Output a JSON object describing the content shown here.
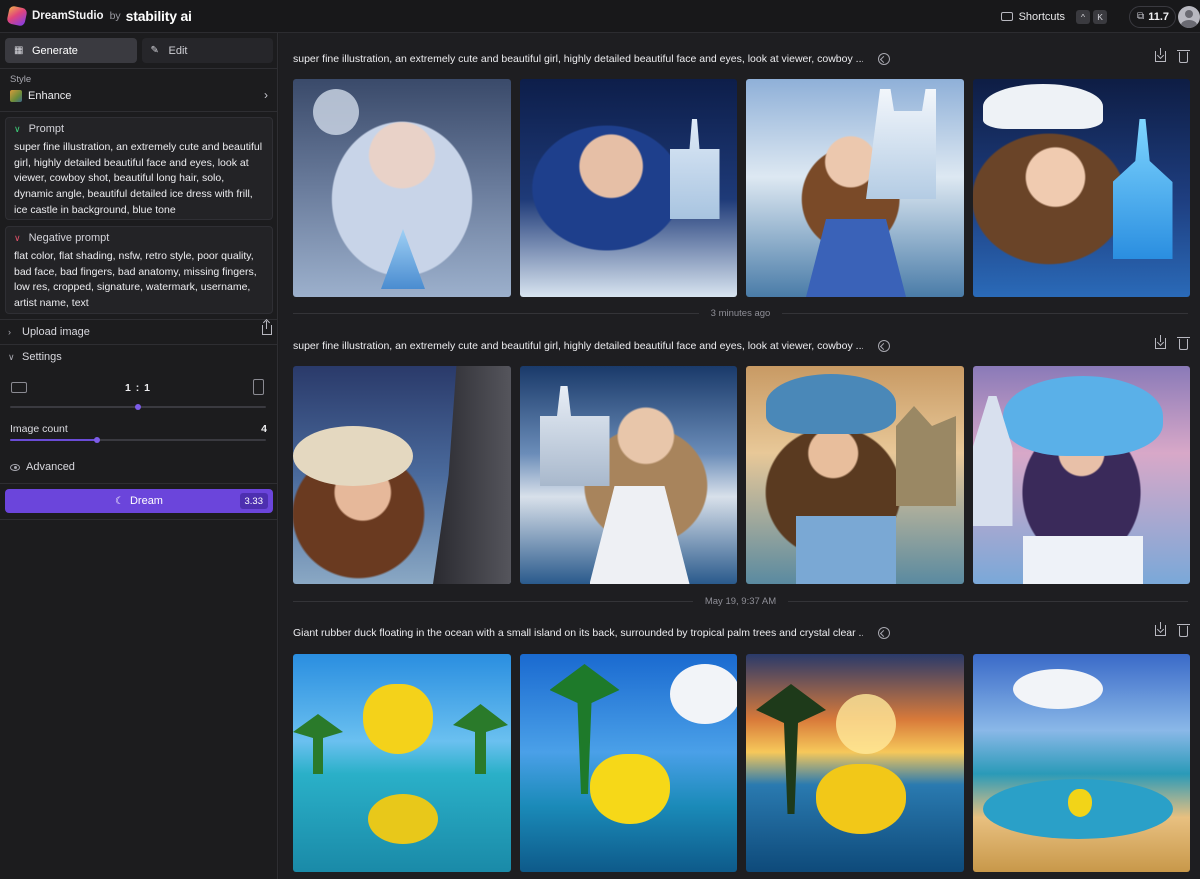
{
  "topbar": {
    "app_name": "DreamStudio",
    "by": "by",
    "company": "stability ai",
    "shortcuts_label": "Shortcuts",
    "keys": [
      "^",
      "K"
    ],
    "credits": "11.7"
  },
  "sidebar": {
    "tabs": [
      {
        "label": "Generate",
        "active": true
      },
      {
        "label": "Edit",
        "active": false
      }
    ],
    "style_label": "Style",
    "style_value": "Enhance",
    "prompt_title": "Prompt",
    "prompt_text": "super fine illustration, an extremely cute and beautiful girl, highly detailed beautiful face and eyes, look at viewer, cowboy shot, beautiful long hair, solo, dynamic angle, beautiful detailed ice dress with frill, ice castle in background, blue tone",
    "negative_title": "Negative prompt",
    "negative_text": "flat color, flat shading, nsfw, retro style, poor quality, bad face, bad fingers, bad anatomy, missing fingers, low res, cropped, signature, watermark, username, artist name, text",
    "upload_label": "Upload image",
    "settings_label": "Settings",
    "aspect_ratio": "1 : 1",
    "aspect_slider_fraction": 0.5,
    "image_count_label": "Image count",
    "image_count": "4",
    "image_count_fraction": 0.34,
    "advanced_label": "Advanced",
    "dream_label": "Dream",
    "dream_cost": "3.33"
  },
  "feed": {
    "groups": [
      {
        "prompt": "super fine illustration, an extremely cute and beautiful girl, highly detailed beautiful face and eyes, look at viewer, cowboy ...",
        "images": [
          "ice-queen-silver-hair",
          "ice-queen-blue-hair",
          "brunette-ice-castle",
          "white-hat-ice-castle"
        ]
      },
      {
        "prompt": "super fine illustration, an extremely cute and beautiful girl, highly detailed beautiful face and eyes, look at viewer, cowboy ...",
        "images": [
          "cowgirl-white-hat-cliffs",
          "tiara-white-dress-castle",
          "blue-hat-stone-castle",
          "blue-hat-ice-castle"
        ]
      },
      {
        "prompt": "Giant rubber duck floating in the ocean with a small island on its back, surrounded by tropical palm trees and crystal clear ...",
        "images": [
          "duck-tropical-island",
          "duck-palm-blue-sky",
          "duck-sunset-sea",
          "duck-lagoon-pool"
        ]
      }
    ],
    "separators": [
      "3 minutes ago",
      "May 19, 9:37 AM"
    ]
  },
  "colors": {
    "accent": "#6b45db",
    "prompt_indicator": "#3ecf7a",
    "negative_indicator": "#e0526a"
  }
}
